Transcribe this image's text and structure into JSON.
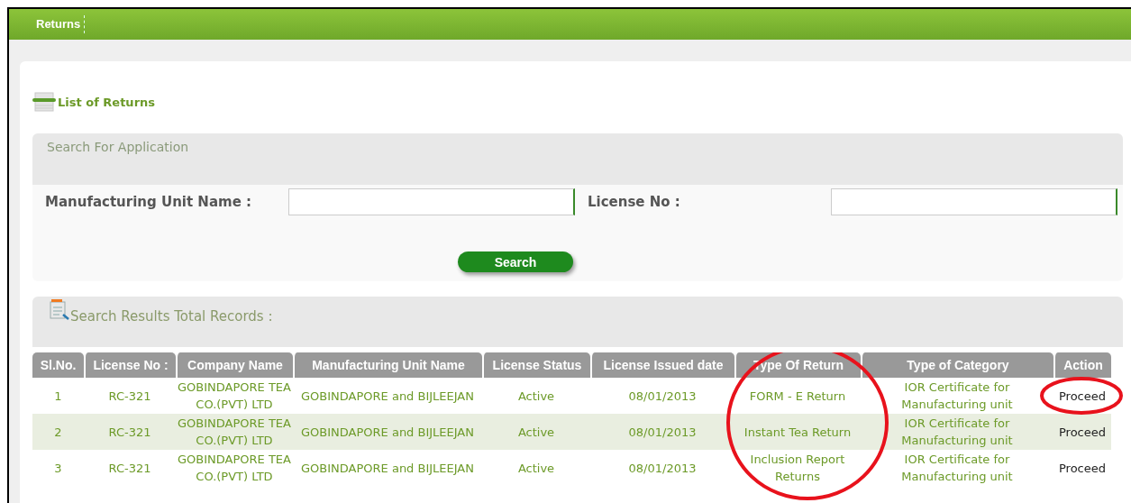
{
  "top_bar": {
    "tabs": [
      {
        "label": "Returns"
      }
    ]
  },
  "page_title": "List of Returns",
  "search_panel": {
    "title": "Search For Application",
    "fields": [
      {
        "label": "Manufacturing Unit Name :"
      },
      {
        "label": "License No :"
      }
    ],
    "button": "Search"
  },
  "results": {
    "title": "Search Results Total Records :",
    "columns": [
      "Sl.No.",
      "License No :",
      "Company Name",
      "Manufacturing Unit Name",
      "License Status",
      "License Issued date",
      "Type Of Return",
      "Type of Category",
      "Action"
    ],
    "rows": [
      [
        "1",
        "RC-321",
        "GOBINDAPORE TEA CO.(PVT) LTD",
        "GOBINDAPORE and BIJLEEJAN",
        "Active",
        "08/01/2013",
        "FORM - E Return",
        "IOR Certificate for Manufacturing unit",
        "Proceed"
      ],
      [
        "2",
        "RC-321",
        "GOBINDAPORE TEA CO.(PVT) LTD",
        "GOBINDAPORE and BIJLEEJAN",
        "Active",
        "08/01/2013",
        "Instant Tea Return",
        "IOR Certificate for Manufacturing unit",
        "Proceed"
      ],
      [
        "3",
        "RC-321",
        "GOBINDAPORE TEA CO.(PVT) LTD",
        "GOBINDAPORE and BIJLEEJAN",
        "Active",
        "08/01/2013",
        "Inclusion Report Returns",
        "IOR Certificate for Manufacturing unit",
        "Proceed"
      ]
    ]
  }
}
